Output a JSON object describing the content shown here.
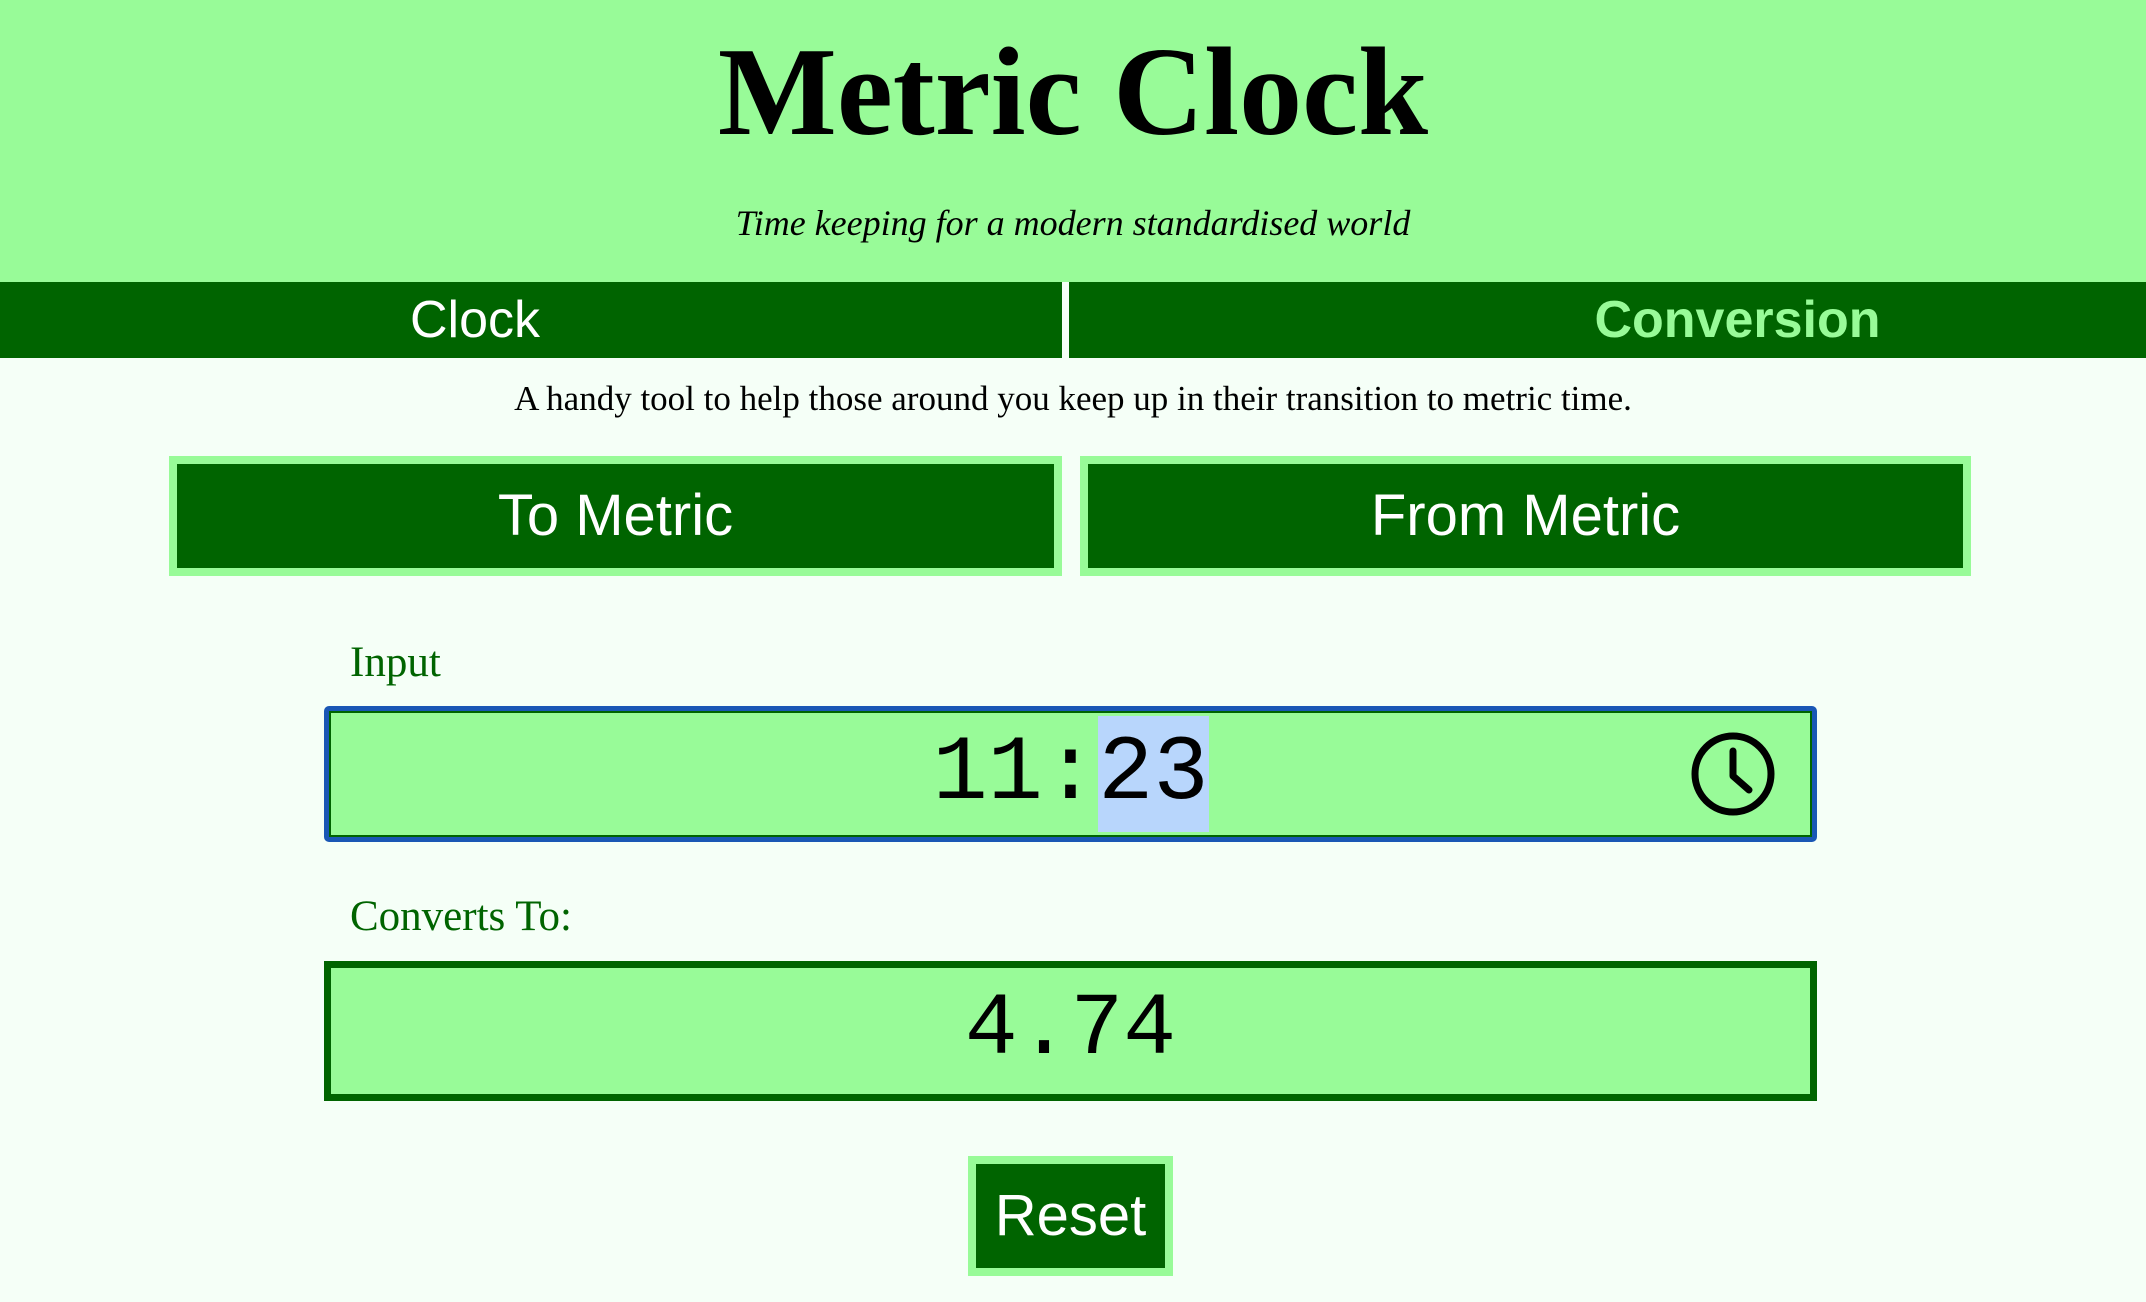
{
  "header": {
    "title": "Metric Clock",
    "subtitle": "Time keeping for a modern standardised world"
  },
  "nav": {
    "tabs": [
      {
        "label": "Clock",
        "active": false
      },
      {
        "label": "Conversion",
        "active": true
      }
    ]
  },
  "main": {
    "tagline": "A handy tool to help those around you keep up in their transition to metric time.",
    "mode_buttons": {
      "to_metric": "To Metric",
      "from_metric": "From Metric"
    },
    "input": {
      "label": "Input",
      "hours": "11",
      "separator": ":",
      "minutes": "23",
      "selected_segment": "minutes",
      "icon": "clock-icon"
    },
    "output": {
      "label": "Converts To:",
      "value": "4.74"
    },
    "reset_label": "Reset"
  },
  "colors": {
    "header_bg": "#98fb98",
    "nav_bg": "#006400",
    "page_bg": "#f5fff7",
    "accent_text": "#006400",
    "active_tab_text": "#98fb98",
    "focus_border": "#1a57b5",
    "selection": "#b8d6fc"
  }
}
